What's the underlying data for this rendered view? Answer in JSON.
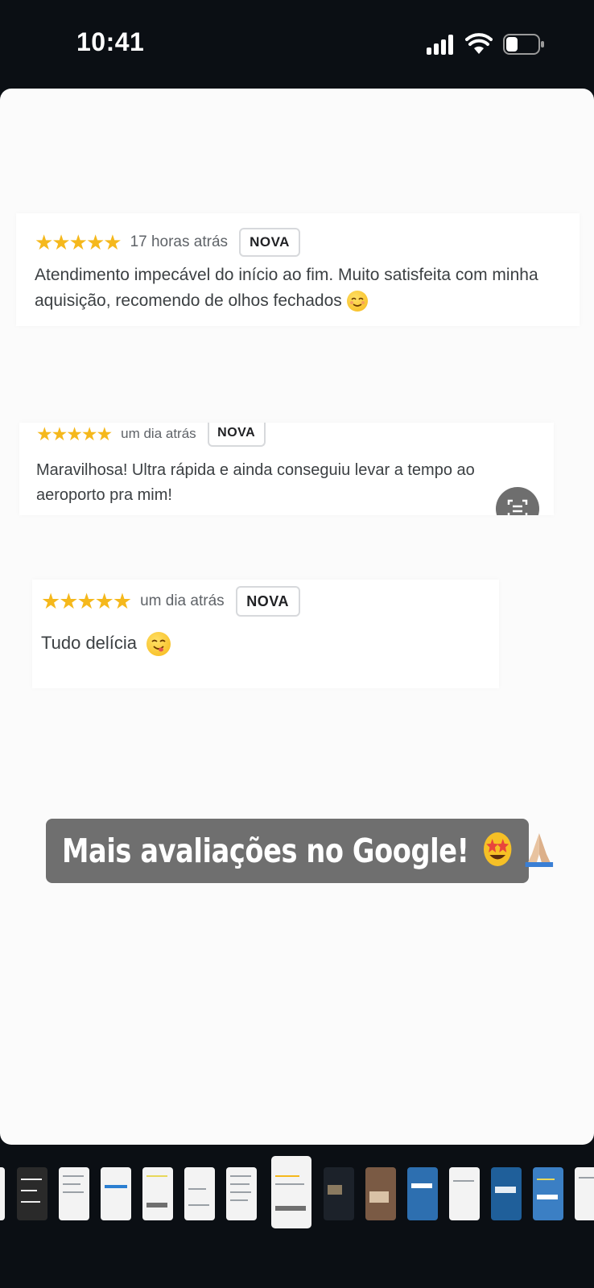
{
  "status_bar": {
    "time": "10:41"
  },
  "reviews": [
    {
      "stars": 5,
      "time_ago": "17 horas atrás",
      "badge": "NOVA",
      "text": "Atendimento impecável do início ao fim. Muito satisfeita com minha aquisição, recomendo de olhos fechados"
    },
    {
      "stars": 5,
      "time_ago": "um dia atrás",
      "badge": "NOVA",
      "text": "Maravilhosa! Ultra rápida e ainda conseguiu levar a tempo ao aeroporto pra mim!"
    },
    {
      "stars": 5,
      "time_ago": "um dia atrás",
      "badge": "NOVA",
      "text": "Tudo delícia"
    }
  ],
  "caption": {
    "text": "Mais avaliações no Google!"
  },
  "icons": {
    "relieved_face": "smiling-relieved-face-emoji",
    "yum_face": "face-savoring-food-emoji",
    "star_struck": "star-struck-emoji",
    "folded_hands": "folded-hands-emoji",
    "lens": "visual-lookup-icon"
  },
  "colors": {
    "star": "#f5b81c",
    "caption_bg": "#6f6f6f"
  },
  "thumbnail_strip": {
    "count": 15,
    "selected_index": 7
  }
}
